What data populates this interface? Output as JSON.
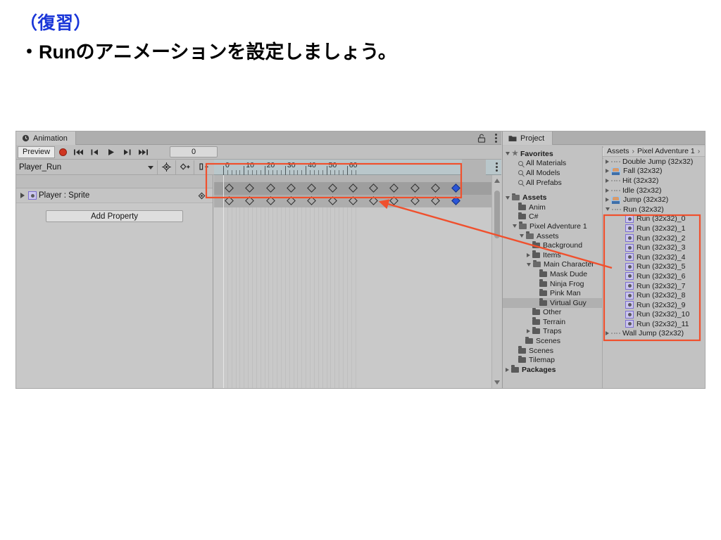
{
  "slide": {
    "heading_review": "（復習）",
    "heading_task": "・Runのアニメーションを設定しましょう。"
  },
  "animation_panel": {
    "tab_label": "Animation",
    "tab_icon": "clock-icon",
    "lock_icon": "lock-open-icon",
    "menu_icon": "kebab-menu-icon",
    "toolbar": {
      "preview_label": "Preview",
      "record_icon": "record-circle-icon",
      "first_frame_icon": "skip-to-start-icon",
      "prev_frame_icon": "step-back-icon",
      "play_icon": "play-icon",
      "next_frame_icon": "step-forward-icon",
      "last_frame_icon": "skip-to-end-icon",
      "frame_value": "0"
    },
    "clip_row": {
      "clip_name": "Player_Run",
      "dropdown_icon": "chevron-down-icon",
      "add_keyframe_icon": "add-keyframe-icon",
      "add_keyframe_plus_icon": "add-keyframe-plus-icon",
      "add_event_icon": "add-event-icon"
    },
    "hierarchy": {
      "property_expand_icon": "triangle-right-icon",
      "property_sprite_icon": "sprite-icon",
      "property_label": "Player : Sprite",
      "property_key_icon": "keyframe-diamond-icon",
      "add_property_label": "Add Property"
    },
    "timeline": {
      "tick_labels": [
        "0",
        "10",
        "20",
        "30",
        "40",
        "50",
        "60"
      ],
      "keyframe_count": 12,
      "selected_keyframe_index": 11,
      "scrollbar_icon": "vertical-scrollbar"
    }
  },
  "project_panel": {
    "tab_label": "Project",
    "tab_icon": "folder-icon",
    "toolbar": {
      "add_icon": "plus-icon",
      "add_caret_icon": "chevron-down-icon",
      "search_icon": "search-icon",
      "search_placeholder": ""
    },
    "tree": [
      {
        "label": "Favorites",
        "indent": 0,
        "state": "expanded",
        "icon": "star-icon",
        "bold": true,
        "selected": false
      },
      {
        "label": "All Materials",
        "indent": 1,
        "state": "leaf",
        "icon": "search-icon",
        "bold": false,
        "selected": false
      },
      {
        "label": "All Models",
        "indent": 1,
        "state": "leaf",
        "icon": "search-icon",
        "bold": false,
        "selected": false
      },
      {
        "label": "All Prefabs",
        "indent": 1,
        "state": "leaf",
        "icon": "search-icon",
        "bold": false,
        "selected": false
      },
      {
        "label": "",
        "indent": 0,
        "state": "spacer",
        "icon": "",
        "bold": false,
        "selected": false
      },
      {
        "label": "Assets",
        "indent": 0,
        "state": "expanded",
        "icon": "folder-open-icon",
        "bold": true,
        "selected": false
      },
      {
        "label": "Anim",
        "indent": 1,
        "state": "leaf",
        "icon": "folder-icon",
        "bold": false,
        "selected": false
      },
      {
        "label": "C#",
        "indent": 1,
        "state": "leaf",
        "icon": "folder-icon",
        "bold": false,
        "selected": false
      },
      {
        "label": "Pixel Adventure 1",
        "indent": 1,
        "state": "expanded",
        "icon": "folder-open-icon",
        "bold": false,
        "selected": false
      },
      {
        "label": "Assets",
        "indent": 2,
        "state": "expanded",
        "icon": "folder-open-icon",
        "bold": false,
        "selected": false
      },
      {
        "label": "Background",
        "indent": 3,
        "state": "leaf",
        "icon": "folder-icon",
        "bold": false,
        "selected": false
      },
      {
        "label": "Items",
        "indent": 3,
        "state": "collapsed",
        "icon": "folder-icon",
        "bold": false,
        "selected": false
      },
      {
        "label": "Main Character",
        "indent": 3,
        "state": "expanded",
        "icon": "folder-open-icon",
        "bold": false,
        "selected": false
      },
      {
        "label": "Mask Dude",
        "indent": 4,
        "state": "leaf",
        "icon": "folder-icon",
        "bold": false,
        "selected": false
      },
      {
        "label": "Ninja Frog",
        "indent": 4,
        "state": "leaf",
        "icon": "folder-icon",
        "bold": false,
        "selected": false
      },
      {
        "label": "Pink Man",
        "indent": 4,
        "state": "leaf",
        "icon": "folder-icon",
        "bold": false,
        "selected": false
      },
      {
        "label": "Virtual Guy",
        "indent": 4,
        "state": "leaf",
        "icon": "folder-icon",
        "bold": false,
        "selected": true
      },
      {
        "label": "Other",
        "indent": 3,
        "state": "leaf",
        "icon": "folder-icon",
        "bold": false,
        "selected": false
      },
      {
        "label": "Terrain",
        "indent": 3,
        "state": "leaf",
        "icon": "folder-icon",
        "bold": false,
        "selected": false
      },
      {
        "label": "Traps",
        "indent": 3,
        "state": "collapsed",
        "icon": "folder-icon",
        "bold": false,
        "selected": false
      },
      {
        "label": "Scenes",
        "indent": 2,
        "state": "leaf",
        "icon": "folder-icon",
        "bold": false,
        "selected": false
      },
      {
        "label": "Scenes",
        "indent": 1,
        "state": "leaf",
        "icon": "folder-icon",
        "bold": false,
        "selected": false
      },
      {
        "label": "Tilemap",
        "indent": 1,
        "state": "leaf",
        "icon": "folder-icon",
        "bold": false,
        "selected": false
      },
      {
        "label": "Packages",
        "indent": 0,
        "state": "collapsed",
        "icon": "folder-icon",
        "bold": true,
        "selected": false
      }
    ],
    "breadcrumb": [
      "Assets",
      "Pixel Adventure 1",
      ""
    ],
    "assets": [
      {
        "label": "Double Jump (32x32)",
        "state": "collapsed",
        "icon": "animation-strip-icon",
        "child": false
      },
      {
        "label": "Fall (32x32)",
        "state": "collapsed",
        "icon": "sprite-sheet-icon",
        "child": false
      },
      {
        "label": "Hit (32x32)",
        "state": "collapsed",
        "icon": "animation-strip-icon",
        "child": false
      },
      {
        "label": "Idle (32x32)",
        "state": "collapsed",
        "icon": "animation-strip-icon",
        "child": false
      },
      {
        "label": "Jump (32x32)",
        "state": "collapsed",
        "icon": "sprite-sheet-icon",
        "child": false
      },
      {
        "label": "Run (32x32)",
        "state": "expanded",
        "icon": "animation-strip-icon",
        "child": false
      },
      {
        "label": "Run (32x32)_0",
        "state": "leaf",
        "icon": "sub-sprite-icon",
        "child": true
      },
      {
        "label": "Run (32x32)_1",
        "state": "leaf",
        "icon": "sub-sprite-icon",
        "child": true
      },
      {
        "label": "Run (32x32)_2",
        "state": "leaf",
        "icon": "sub-sprite-icon",
        "child": true
      },
      {
        "label": "Run (32x32)_3",
        "state": "leaf",
        "icon": "sub-sprite-icon",
        "child": true
      },
      {
        "label": "Run (32x32)_4",
        "state": "leaf",
        "icon": "sub-sprite-icon",
        "child": true
      },
      {
        "label": "Run (32x32)_5",
        "state": "leaf",
        "icon": "sub-sprite-icon",
        "child": true
      },
      {
        "label": "Run (32x32)_6",
        "state": "leaf",
        "icon": "sub-sprite-icon",
        "child": true
      },
      {
        "label": "Run (32x32)_7",
        "state": "leaf",
        "icon": "sub-sprite-icon",
        "child": true
      },
      {
        "label": "Run (32x32)_8",
        "state": "leaf",
        "icon": "sub-sprite-icon",
        "child": true
      },
      {
        "label": "Run (32x32)_9",
        "state": "leaf",
        "icon": "sub-sprite-icon",
        "child": true
      },
      {
        "label": "Run (32x32)_10",
        "state": "leaf",
        "icon": "sub-sprite-icon",
        "child": true
      },
      {
        "label": "Run (32x32)_11",
        "state": "leaf",
        "icon": "sub-sprite-icon",
        "child": true
      },
      {
        "label": "Wall Jump (32x32)",
        "state": "collapsed",
        "icon": "animation-strip-icon",
        "child": false
      }
    ]
  },
  "annotations": {
    "highlight_color": "#f0502d",
    "keyframe_box": "red rectangle around the 12 sprite keyframes in the Animation timeline",
    "sprite_box": "red rectangle around Run (32x32) and its 12 child sprites",
    "arrow": "red arrow from the Run sprite list to the keyframe track"
  },
  "colors": {
    "heading_blue": "#1a36d8",
    "accent_red": "#f0502d",
    "selected_keyframe_blue": "#2a56d8",
    "panel_gray": "#c2c2c2",
    "ruler_blue_gray": "#b9c7cb"
  }
}
